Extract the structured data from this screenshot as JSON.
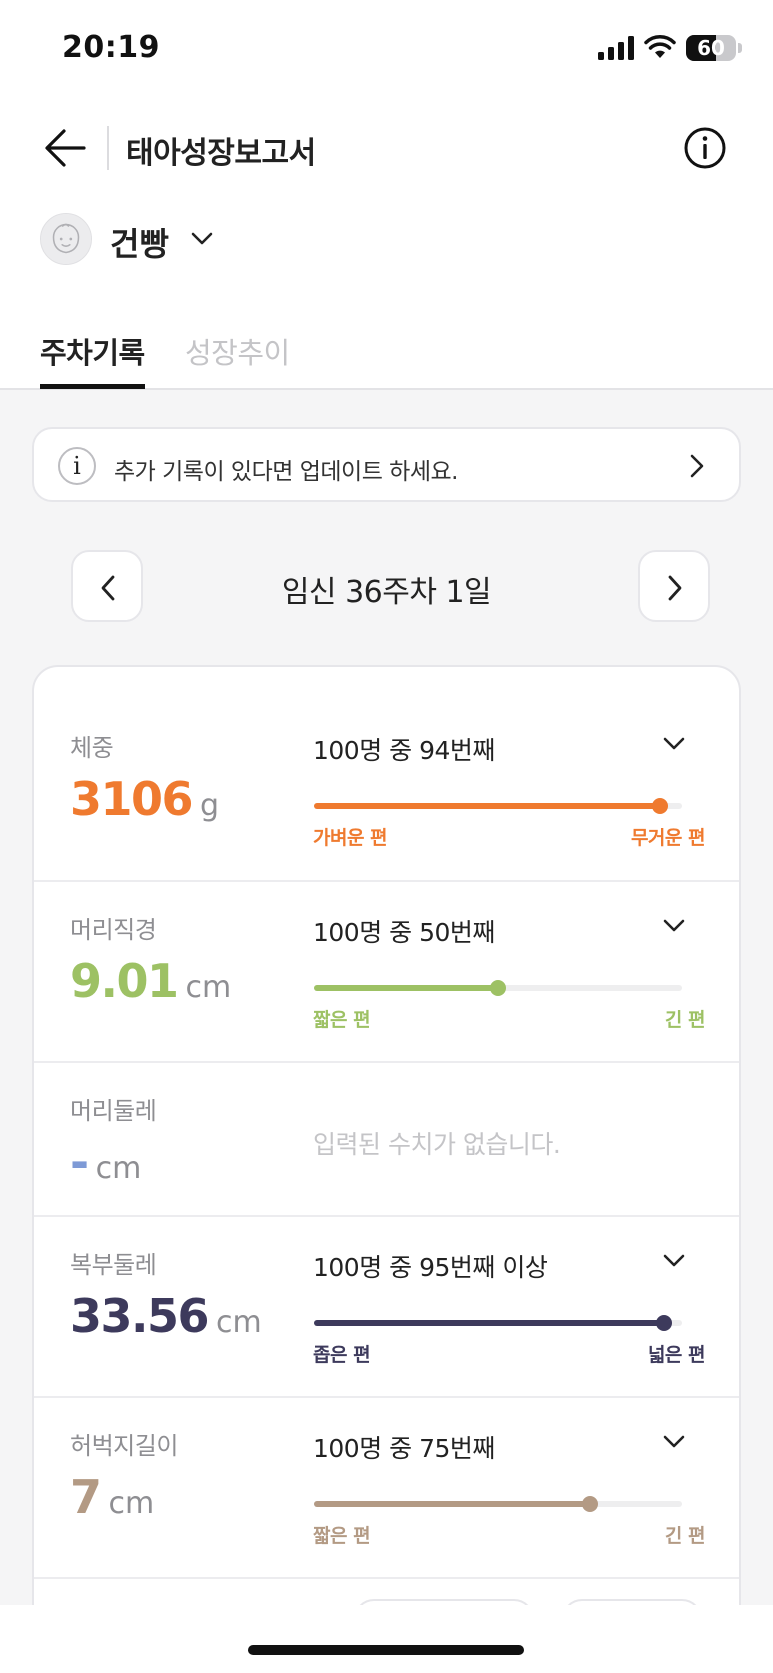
{
  "status_bar": {
    "time": "20:19",
    "battery": "60",
    "battery_level": 0.6
  },
  "header": {
    "title": "태아성장보고서"
  },
  "baby": {
    "name": "건빵"
  },
  "tabs": [
    {
      "label": "주차기록",
      "active": true
    },
    {
      "label": "성장추이",
      "active": false
    }
  ],
  "notice": {
    "text": "추가 기록이 있다면 업데이트 하세요."
  },
  "week": {
    "label": "임신 36주차 1일"
  },
  "metrics": [
    {
      "label": "체중",
      "value": "3106",
      "unit": "g",
      "rank": "100명 중 94번째",
      "percentile": 94,
      "left_label": "가벼운 편",
      "right_label": "무거운 편",
      "color": "#ef7a2f"
    },
    {
      "label": "머리직경",
      "value": "9.01",
      "unit": "cm",
      "rank": "100명 중 50번째",
      "percentile": 50,
      "left_label": "짧은 편",
      "right_label": "긴 편",
      "color": "#9dc164"
    },
    {
      "label": "머리둘레",
      "value": "-",
      "unit": "cm",
      "empty_text": "입력된 수치가 없습니다.",
      "color": "#7e9ad6"
    },
    {
      "label": "복부둘레",
      "value": "33.56",
      "unit": "cm",
      "rank": "100명 중 95번째 이상",
      "percentile": 95,
      "left_label": "좁은 편",
      "right_label": "넓은 편",
      "color": "#3d3a5c"
    },
    {
      "label": "허벅지길이",
      "value": "7",
      "unit": "cm",
      "rank": "100명 중 75번째",
      "percentile": 75,
      "left_label": "짧은 편",
      "right_label": "긴 편",
      "color": "#b39a84"
    }
  ]
}
